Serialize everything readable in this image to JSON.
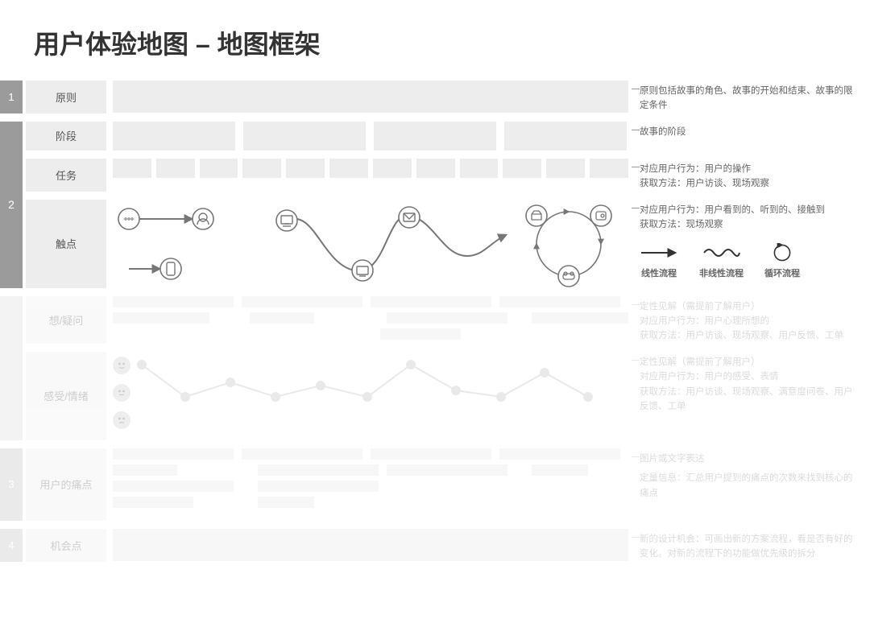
{
  "title": "用户体验地图 – 地图框架",
  "rows": {
    "r1": {
      "num": "1",
      "label": "原则",
      "desc": "原则包括故事的角色、故事的开始和结束、故事的限定条件"
    },
    "r2a": {
      "label": "阶段",
      "desc": "故事的阶段"
    },
    "r2b": {
      "label": "任务",
      "desc1": "对应用户行为：用户的操作",
      "desc2": "获取方法：用户访谈、现场观察"
    },
    "r2c": {
      "label": "触点",
      "desc1": "对应用户行为：用户看到的、听到的、接触到",
      "desc2": "获取方法：现场观察"
    },
    "num2": "2",
    "legend": {
      "linear": "线性流程",
      "nonlinear": "非线性流程",
      "loop": "循环流程"
    },
    "r3a": {
      "label": "想/疑问",
      "desc1": "定性见解（需提前了解用户）",
      "desc2": "对应用户行为：用户心理所想的",
      "desc3": "获取方法：用户访谈、现场观察、用户反馈、工单"
    },
    "r3b": {
      "label": "感受/情绪",
      "desc1": "定性见解（需提前了解用户）",
      "desc2": "对应用户行为：用户的感受、表情",
      "desc3": "获取方法：用户访谈、现场观察、满意度问卷、用户反馈、工单"
    },
    "r4": {
      "num": "3",
      "label": "用户的痛点",
      "desc1": "图片或文字表达",
      "desc2": "定量信息：汇总用户提到的痛点的次数来找到核心的痛点"
    },
    "r5": {
      "num": "4",
      "label": "机会点",
      "desc": "新的设计机会：可画出新的方案流程，看是否有好的变化。对新的流程下的功能做优先级的拆分"
    }
  }
}
